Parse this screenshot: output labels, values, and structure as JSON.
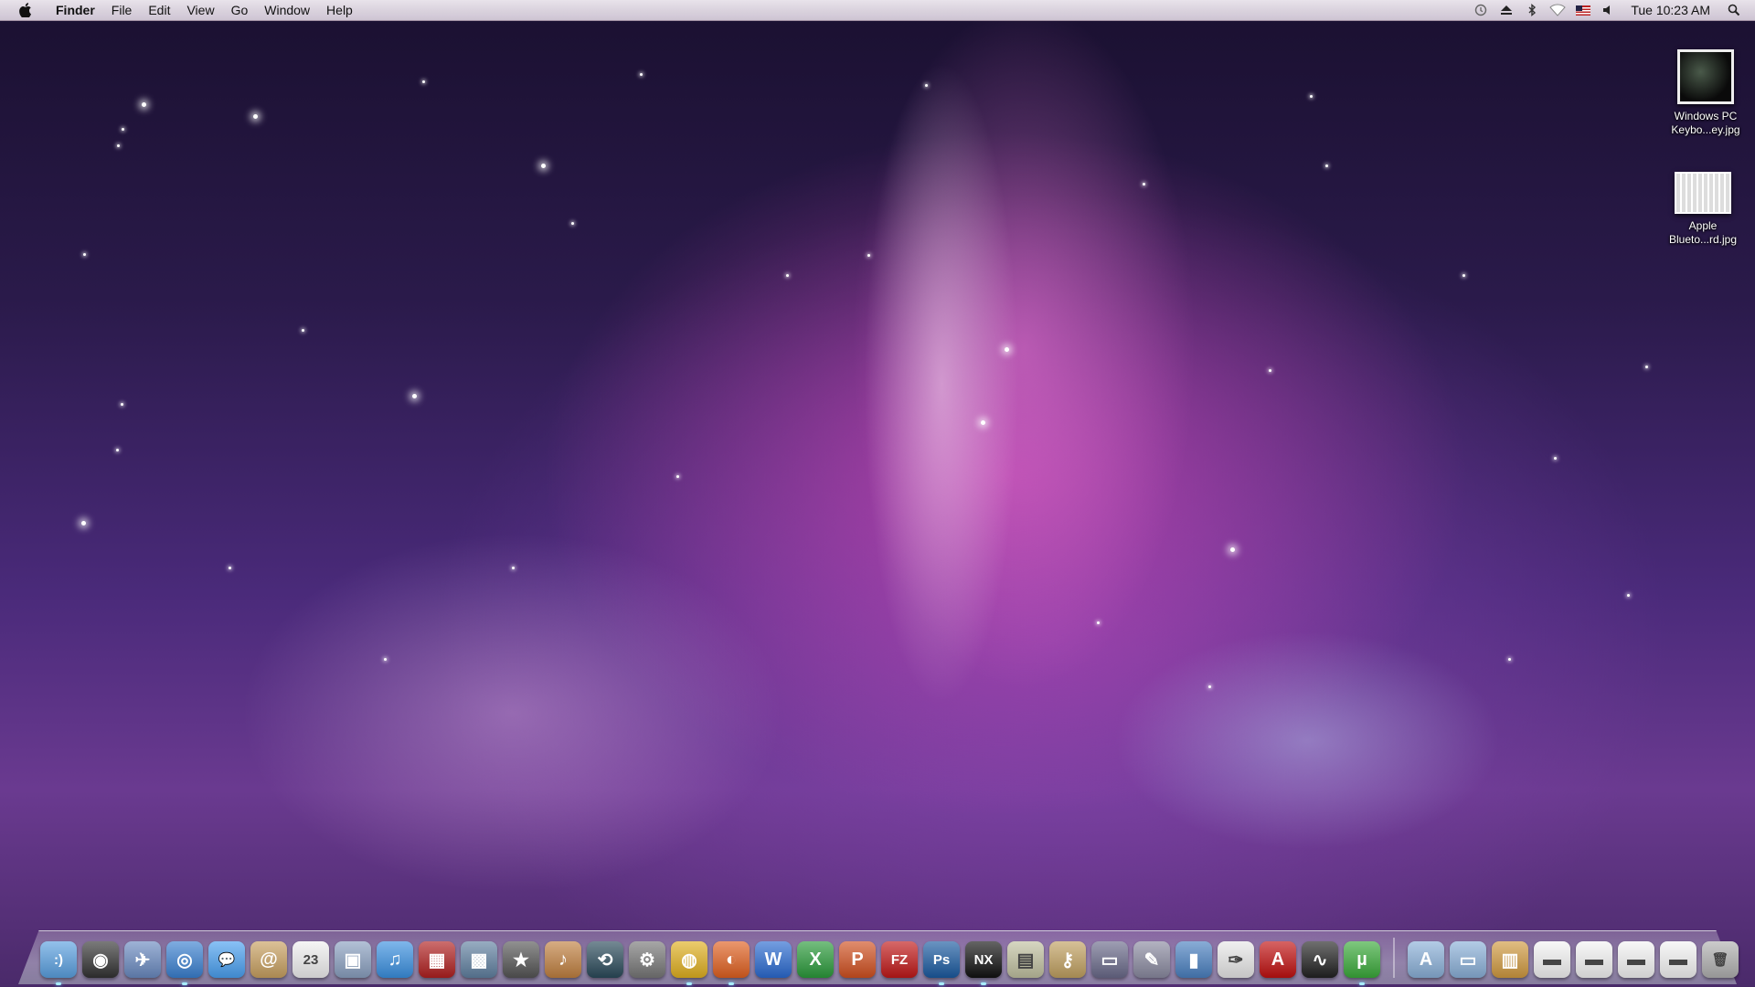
{
  "menubar": {
    "app_name": "Finder",
    "menus": [
      "File",
      "Edit",
      "View",
      "Go",
      "Window",
      "Help"
    ],
    "status_icons": [
      "time-machine-icon",
      "eject-icon",
      "bluetooth-icon",
      "wifi-icon",
      "us-flag-input-icon",
      "volume-icon"
    ],
    "clock": "Tue 10:23 AM"
  },
  "desktop": {
    "icons": [
      {
        "line1": "Windows PC",
        "line2": "Keybo...ey.jpg"
      },
      {
        "line1": "Apple",
        "line2": "Blueto...rd.jpg"
      }
    ]
  },
  "dock": {
    "apps": [
      {
        "name": "finder",
        "color": "#5aa0e0",
        "glyph": ":)"
      },
      {
        "name": "dashboard",
        "color": "#333",
        "glyph": "◉"
      },
      {
        "name": "mail-stamp",
        "color": "#6a8ac0",
        "glyph": "✈"
      },
      {
        "name": "safari",
        "color": "#3a80d0",
        "glyph": "◎"
      },
      {
        "name": "ichat",
        "color": "#4aa0f0",
        "glyph": "💬"
      },
      {
        "name": "address-book",
        "color": "#c8a060",
        "glyph": "@"
      },
      {
        "name": "ical",
        "color": "#f0f0f0",
        "glyph": "23"
      },
      {
        "name": "preview",
        "color": "#8aa0c0",
        "glyph": "▣"
      },
      {
        "name": "itunes",
        "color": "#3a90e0",
        "glyph": "♫"
      },
      {
        "name": "photo-booth",
        "color": "#b02020",
        "glyph": "▦"
      },
      {
        "name": "iphoto",
        "color": "#6080a0",
        "glyph": "▩"
      },
      {
        "name": "imovie",
        "color": "#555",
        "glyph": "★"
      },
      {
        "name": "garageband",
        "color": "#c08040",
        "glyph": "♪"
      },
      {
        "name": "time-machine",
        "color": "#2a4a5a",
        "glyph": "⟲"
      },
      {
        "name": "system-preferences",
        "color": "#777",
        "glyph": "⚙"
      },
      {
        "name": "chrome",
        "color": "#e0b020",
        "glyph": "◍"
      },
      {
        "name": "firefox",
        "color": "#e06020",
        "glyph": "◐"
      },
      {
        "name": "word",
        "color": "#2a6ad0",
        "glyph": "W"
      },
      {
        "name": "excel",
        "color": "#2a9a3a",
        "glyph": "X"
      },
      {
        "name": "powerpoint",
        "color": "#d05020",
        "glyph": "P"
      },
      {
        "name": "filezilla",
        "color": "#c01818",
        "glyph": "FZ"
      },
      {
        "name": "photoshop",
        "color": "#1a5aa0",
        "glyph": "Ps"
      },
      {
        "name": "nx",
        "color": "#111",
        "glyph": "NX"
      },
      {
        "name": "image-capture",
        "color": "#c0c0a0",
        "glyph": "▤"
      },
      {
        "name": "lock-utility",
        "color": "#c0a060",
        "glyph": "⚷"
      },
      {
        "name": "keynote",
        "color": "#6a6a8a",
        "glyph": "▭"
      },
      {
        "name": "script-editor",
        "color": "#8a8aa0",
        "glyph": "✎"
      },
      {
        "name": "grapher",
        "color": "#4a80c0",
        "glyph": "▮"
      },
      {
        "name": "textedit",
        "color": "#e8e8e8",
        "glyph": "✑"
      },
      {
        "name": "acrobat",
        "color": "#c01010",
        "glyph": "A"
      },
      {
        "name": "activity-monitor",
        "color": "#222",
        "glyph": "∿"
      },
      {
        "name": "utorrent",
        "color": "#3aaa3a",
        "glyph": "µ"
      }
    ],
    "stacks": [
      {
        "name": "applications-folder",
        "color": "#8ab0d8",
        "glyph": "A"
      },
      {
        "name": "documents-folder",
        "color": "#8ab0d8",
        "glyph": "▭"
      },
      {
        "name": "downloads-archive",
        "color": "#d09a40",
        "glyph": "▥"
      },
      {
        "name": "doc-stack-1",
        "color": "#f4f4f4",
        "glyph": "▬"
      },
      {
        "name": "doc-stack-2",
        "color": "#f4f4f4",
        "glyph": "▬"
      },
      {
        "name": "doc-stack-3",
        "color": "#f4f4f4",
        "glyph": "▬"
      },
      {
        "name": "doc-stack-4",
        "color": "#f4f4f4",
        "glyph": "▬"
      },
      {
        "name": "trash",
        "color": "#b0b0b0",
        "glyph": "🗑"
      }
    ]
  }
}
